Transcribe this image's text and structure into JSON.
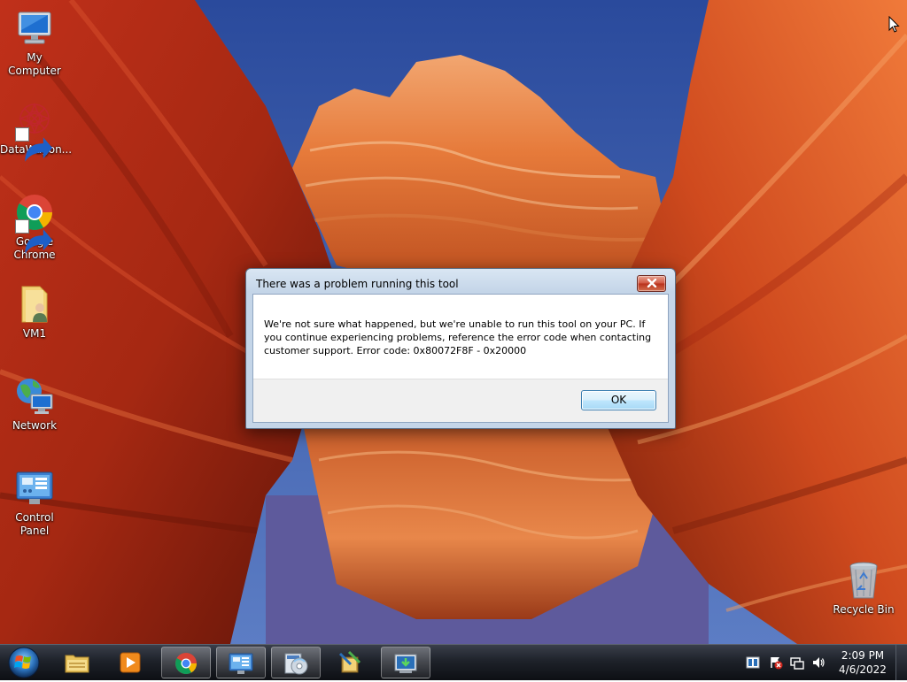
{
  "desktop": {
    "icons": [
      {
        "label": "My Computer",
        "icon": "computer-icon"
      },
      {
        "label": "DataWagon...",
        "icon": "datawagon-icon"
      },
      {
        "label": "Google Chrome",
        "icon": "chrome-icon"
      },
      {
        "label": "VM1",
        "icon": "user-folder-icon"
      },
      {
        "label": "Network",
        "icon": "network-icon"
      },
      {
        "label": "Control Panel",
        "icon": "control-panel-icon"
      },
      {
        "label": "Recycle Bin",
        "icon": "recycle-bin-icon"
      }
    ]
  },
  "dialog": {
    "title": "There was a problem running this tool",
    "message": "We're not sure what happened, but we're unable to run this tool on your PC. If you continue experiencing problems, reference the error code when contacting customer support. Error code: 0x80072F8F - 0x20000",
    "ok_label": "OK",
    "close_icon": "close-icon"
  },
  "taskbar": {
    "start_icon": "windows-logo-icon",
    "buttons": [
      {
        "icon": "file-explorer-icon",
        "active": false
      },
      {
        "icon": "media-player-icon",
        "active": false
      },
      {
        "icon": "chrome-icon",
        "active": true
      },
      {
        "icon": "control-panel-icon",
        "active": true
      },
      {
        "icon": "disc-installer-icon",
        "active": true
      },
      {
        "icon": "setup-tool-icon",
        "active": false
      },
      {
        "icon": "media-creation-tool-icon",
        "active": true
      }
    ],
    "tray": {
      "icons": [
        "keyboard-language-icon",
        "action-center-icon",
        "network-tray-icon",
        "volume-icon"
      ],
      "time": "2:09 PM",
      "date": "4/6/2022"
    }
  }
}
